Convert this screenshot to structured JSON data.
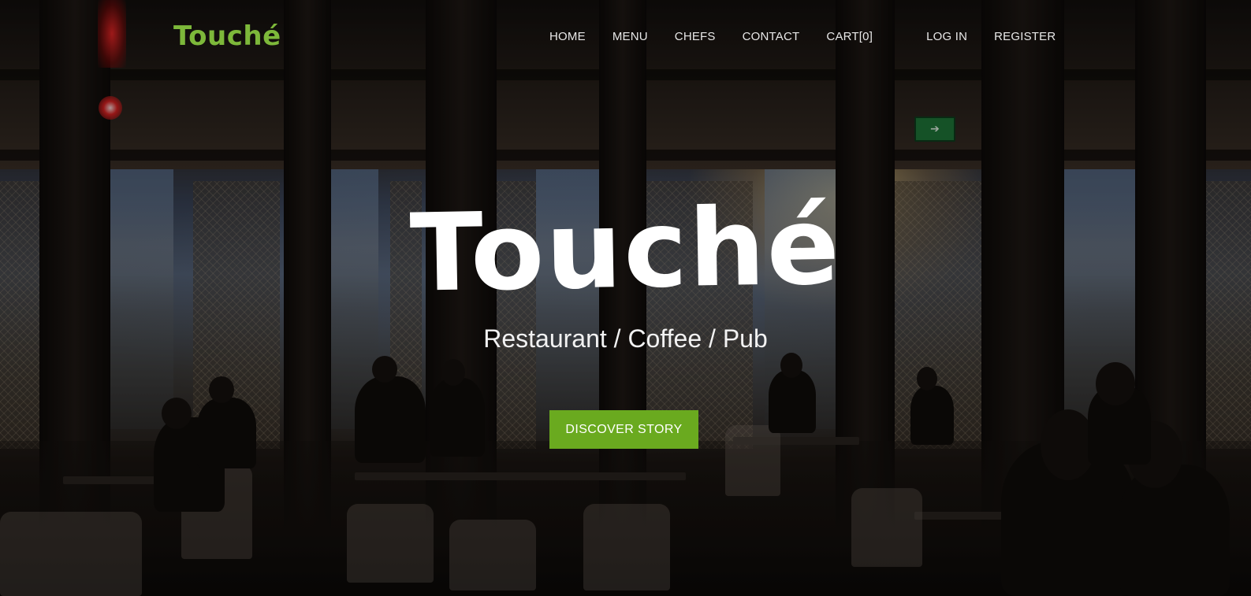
{
  "brand": {
    "logo_text": "Touché",
    "color": "#7db83a"
  },
  "nav": {
    "items": [
      {
        "label": "HOME"
      },
      {
        "label": "MENU"
      },
      {
        "label": "CHEFS"
      },
      {
        "label": "CONTACT"
      },
      {
        "label": "CART[0]"
      },
      {
        "label": "LOG IN"
      },
      {
        "label": "REGISTER"
      }
    ]
  },
  "hero": {
    "title": "Touché",
    "subtitle": "Restaurant / Coffee / Pub",
    "cta_label": "DISCOVER STORY",
    "cta_color": "#6aaa1f"
  },
  "scene": {
    "exit_sign": "➔"
  }
}
